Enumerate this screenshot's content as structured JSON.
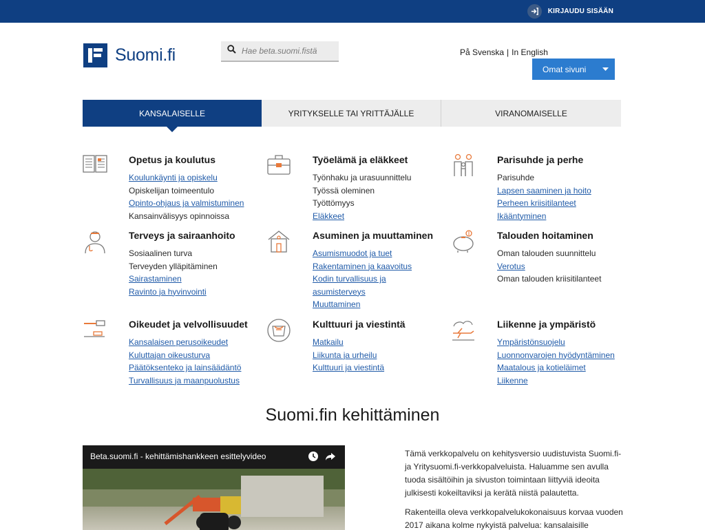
{
  "topbar": {
    "login_label": "KIRJAUDU SISÄÄN",
    "login_icon": "sign-in-icon"
  },
  "header": {
    "logo_text": "Suomi.fi",
    "search_placeholder": "Hae beta.suomi.fistä",
    "lang_sv": "På Svenska",
    "lang_sep": "|",
    "lang_en": "In English",
    "omat_label": "Omat sivuni"
  },
  "tabs": [
    {
      "label": "KANSALAISELLE"
    },
    {
      "label": "YRITYKSELLE TAI YRITTÄJÄLLE"
    },
    {
      "label": "VIRANOMAISELLE"
    }
  ],
  "categories": [
    {
      "title": "Opetus ja koulutus",
      "icon": "book-icon",
      "items": [
        {
          "text": "Koulunkäynti ja opiskelu",
          "link": true
        },
        {
          "text": "Opiskelijan toimeentulo",
          "link": false
        },
        {
          "text": "Opinto-ohjaus ja valmistuminen",
          "link": true
        },
        {
          "text": "Kansainvälisyys opinnoissa",
          "link": false
        }
      ]
    },
    {
      "title": "Työelämä ja eläkkeet",
      "icon": "briefcase-icon",
      "items": [
        {
          "text": "Työnhaku ja urasuunnittelu",
          "link": false
        },
        {
          "text": "Työssä oleminen",
          "link": false
        },
        {
          "text": "Työttömyys",
          "link": false
        },
        {
          "text": "Eläkkeet",
          "link": true
        }
      ]
    },
    {
      "title": "Parisuhde ja perhe",
      "icon": "family-icon",
      "items": [
        {
          "text": "Parisuhde",
          "link": false
        },
        {
          "text": "Lapsen saaminen ja hoito",
          "link": true
        },
        {
          "text": "Perheen kriisitilanteet",
          "link": true
        },
        {
          "text": "Ikääntyminen",
          "link": true
        }
      ]
    },
    {
      "title": "Terveys ja sairaanhoito",
      "icon": "doctor-icon",
      "items": [
        {
          "text": "Sosiaalinen turva",
          "link": false
        },
        {
          "text": "Terveyden ylläpitäminen",
          "link": false
        },
        {
          "text": "Sairastaminen",
          "link": true
        },
        {
          "text": "Ravinto ja hyvinvointi",
          "link": true
        }
      ]
    },
    {
      "title": "Asuminen ja muuttaminen",
      "icon": "house-icon",
      "items": [
        {
          "text": "Asumismuodot ja tuet",
          "link": true
        },
        {
          "text": "Rakentaminen ja kaavoitus",
          "link": true
        },
        {
          "text": "Kodin turvallisuus ja",
          "link": true
        },
        {
          "text": "asumisterveys",
          "link": true
        },
        {
          "text": "Muuttaminen",
          "link": true
        }
      ]
    },
    {
      "title": "Talouden hoitaminen",
      "icon": "piggy-bank-icon",
      "items": [
        {
          "text": "Oman talouden suunnittelu",
          "link": false
        },
        {
          "text": "Verotus",
          "link": true
        },
        {
          "text": "Oman talouden kriisitilanteet",
          "link": false
        }
      ]
    },
    {
      "title": "Oikeudet ja velvollisuudet",
      "icon": "gavel-icon",
      "items": [
        {
          "text": "Kansalaisen perusoikeudet",
          "link": true
        },
        {
          "text": "Kuluttajan oikeusturva",
          "link": true
        },
        {
          "text": "Päätöksenteko ja lainsäädäntö",
          "link": true
        },
        {
          "text": "Turvallisuus ja maanpuolustus",
          "link": true
        }
      ]
    },
    {
      "title": "Kulttuuri ja viestintä",
      "icon": "theater-icon",
      "items": [
        {
          "text": "Matkailu",
          "link": true
        },
        {
          "text": "Liikunta ja urheilu",
          "link": true
        },
        {
          "text": "Kulttuuri ja viestintä",
          "link": true
        }
      ]
    },
    {
      "title": "Liikenne ja ympäristö",
      "icon": "airplane-icon",
      "items": [
        {
          "text": "Ympäristönsuojelu",
          "link": true
        },
        {
          "text": "Luonnonvarojen hyödyntäminen",
          "link": true
        },
        {
          "text": "Maatalous ja kotieläimet",
          "link": true
        },
        {
          "text": "Liikenne",
          "link": true
        }
      ]
    }
  ],
  "section": {
    "title": "Suomi.fin kehittäminen",
    "video_title": "Beta.suomi.fi - kehittämishankkeen esittelyvideo",
    "intro_p1": "Tämä verkkopalvelu on kehitysversio uudistuvista Suomi.fi- ja Yritysuomi.fi-verkkopalveluista. Haluamme sen avulla tuoda sisältöihin ja sivuston toimintaan liittyviä ideoita julkisesti kokeiltaviksi ja kerätä niistä palautetta.",
    "intro_p2": "Rakenteilla oleva verkkopalvelukokonaisuus korvaa vuoden 2017 aikana kolme nykyistä palvelua: kansalaisille"
  },
  "colors": {
    "brand": "#0f3f82",
    "accent": "#2c7ccf",
    "link": "#1f5aa8",
    "icon_orange": "#e8793a"
  }
}
